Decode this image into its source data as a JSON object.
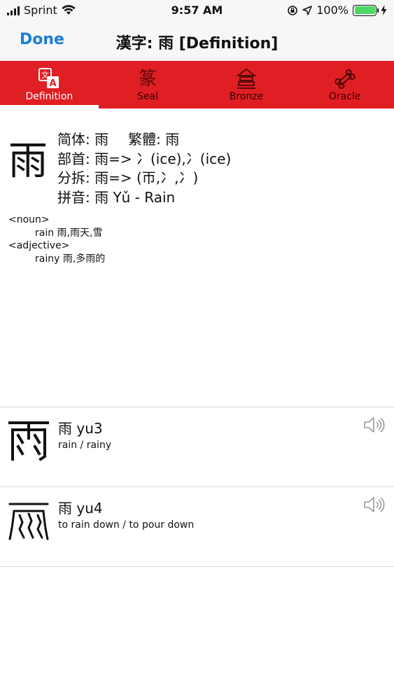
{
  "status": {
    "carrier": "Sprint",
    "time": "9:57 AM",
    "battery": "100%"
  },
  "nav": {
    "done_label": "Done",
    "title": "漢字: 雨 [Definition]"
  },
  "tabs": [
    {
      "label": "Definition",
      "icon": "definition-icon",
      "glyph": ""
    },
    {
      "label": "Seal",
      "icon": "seal-icon",
      "glyph": "篆"
    },
    {
      "label": "Bronze",
      "icon": "bronze-icon",
      "glyph": "𠀤"
    },
    {
      "label": "Oracle",
      "icon": "oracle-bone-icon",
      "glyph": ""
    }
  ],
  "definition": {
    "character": "雨",
    "simplified": "简体: 雨",
    "traditional": "繁體: 雨",
    "radical": "部首: 雨=> 冫(ice),冫(ice)",
    "decomposition": "分拆: 雨=> (帀,冫,冫)",
    "pinyin": "拼音: 雨 Yǔ - Rain",
    "pos_noun": "<noun>",
    "noun_meaning": "rain   雨,雨天,雪",
    "pos_adjective": "<adjective>",
    "adjective_meaning": "rainy 雨,多雨的"
  },
  "entries": [
    {
      "head": "雨  yu3",
      "gloss": "rain / rainy"
    },
    {
      "head": "雨  yu4",
      "gloss": "to rain down / to pour down"
    }
  ],
  "colors": {
    "accent": "#1a7ed7",
    "tabbar": "#e01f24",
    "battery": "#4cd964"
  }
}
